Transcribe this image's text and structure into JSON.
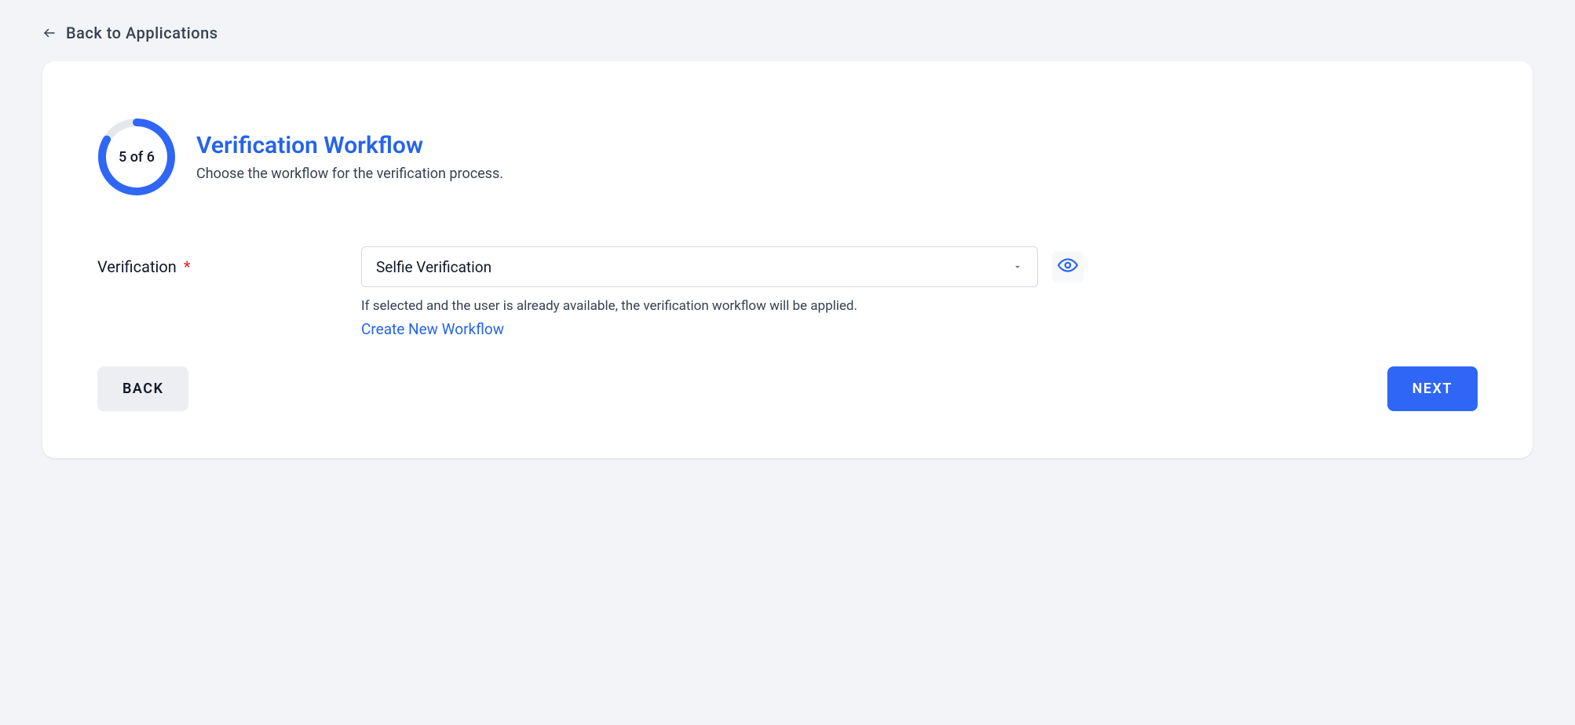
{
  "back": {
    "label": "Back to Applications"
  },
  "progress": {
    "current": 5,
    "total": 6,
    "label": "5 of 6"
  },
  "title": "Verification Workflow",
  "subtitle": "Choose the workflow for the verification process.",
  "form": {
    "verification": {
      "label": "Verification",
      "required": "*",
      "selected": "Selfie Verification",
      "helper": "If selected and the user is already available, the verification workflow will be applied.",
      "createLink": "Create New Workflow"
    }
  },
  "actions": {
    "back": "BACK",
    "next": "NEXT"
  },
  "icons": {
    "arrowLeft": "arrow-left-icon",
    "chevronDown": "chevron-down-icon",
    "eye": "eye-icon"
  },
  "colors": {
    "accent": "#2563eb",
    "ringTrack": "#e5e7eb"
  }
}
